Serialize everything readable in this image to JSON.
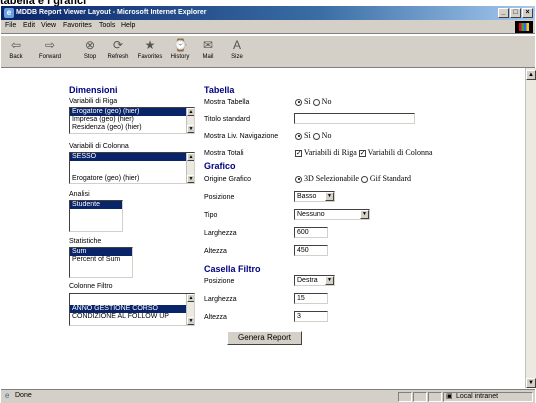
{
  "window": {
    "cut_title": "tabella e i grafici",
    "title": "MDDB Report Viewer Layout - Microsoft Internet Explorer",
    "min_glyph": "_",
    "max_glyph": "□",
    "close_glyph": "×"
  },
  "menu": [
    "File",
    "Edit",
    "View",
    "Favorites",
    "Tools",
    "Help"
  ],
  "toolbar": [
    {
      "label": "Back",
      "icon": "⇦"
    },
    {
      "label": "Forward",
      "icon": "⇨"
    },
    {
      "label": "Stop",
      "icon": "⊗"
    },
    {
      "label": "Refresh",
      "icon": "⟳"
    },
    {
      "label": "Favorites",
      "icon": "★"
    },
    {
      "label": "History",
      "icon": "⌚"
    },
    {
      "label": "Mail",
      "icon": "✉"
    },
    {
      "label": "Size",
      "icon": "A"
    }
  ],
  "dimensioni": {
    "heading": "Dimensioni",
    "riga_label": "Variabili di Riga",
    "riga_items": [
      "Erogatore (geo) (hier)",
      "Impresa (geo) (hier)",
      "Residenza (geo) (hier)"
    ],
    "colonna_label": "Variabili di Colonna",
    "colonna_items": [
      "SESSO",
      "",
      "Erogatore (geo) (hier)"
    ],
    "analisi_label": "Analisi",
    "analisi_items": [
      "Studente"
    ],
    "statistiche_label": "Statistiche",
    "statistiche_items": [
      "Sum",
      "Percent of Sum"
    ],
    "filtro_label": "Colonne Filtro",
    "filtro_items": [
      "",
      "ANNO GESTIONE CORSO",
      "CONDIZIONE AL FOLLOW UP"
    ]
  },
  "tabella": {
    "heading": "Tabella",
    "mostra_label": "Mostra Tabella",
    "si": "Sì",
    "no": "No",
    "titolo_label": "Titolo standard",
    "titolo_value": "",
    "nav_label": "Mostra Liv. Navigazione",
    "totali_label": "Mostra Totali",
    "tot_riga": "Variabili di Riga",
    "tot_colonna": "Variabili di Colonna"
  },
  "grafico": {
    "heading": "Grafico",
    "origine_label": "Origine Grafico",
    "origine_3d": "3D Selezionabile",
    "origine_gif": "Gif Standard",
    "posizione_label": "Posizione",
    "posizione_value": "Basso",
    "tipo_label": "Tipo",
    "tipo_value": "Nessuno",
    "larghezza_label": "Larghezza",
    "larghezza_value": "600",
    "altezza_label": "Altezza",
    "altezza_value": "450"
  },
  "casella": {
    "heading": "Casella Filtro",
    "posizione_label": "Posizione",
    "posizione_value": "Destra",
    "larghezza_label": "Larghezza",
    "larghezza_value": "15",
    "altezza_label": "Altezza",
    "altezza_value": "3"
  },
  "genera_button": "Genera Report",
  "status": {
    "done": "Done",
    "zone": "Local intranet"
  }
}
